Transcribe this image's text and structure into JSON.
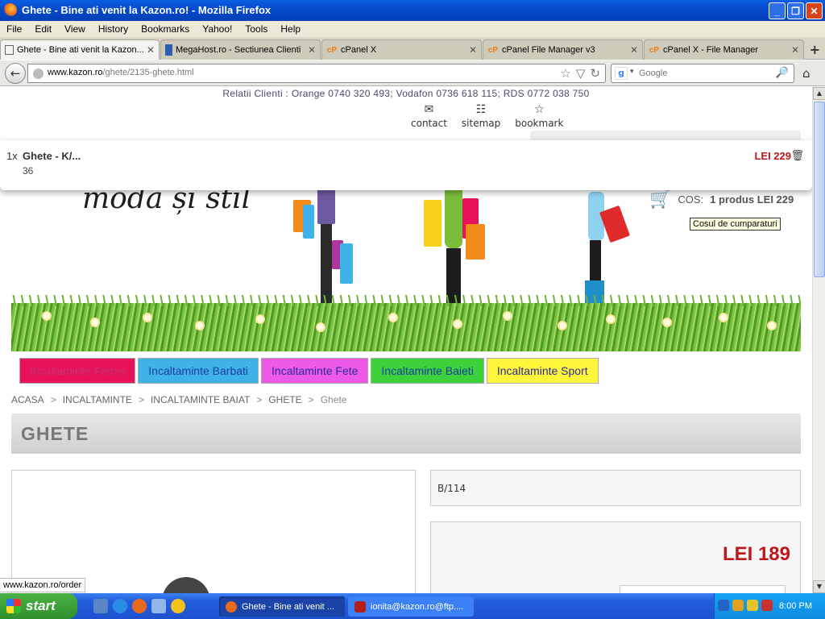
{
  "window": {
    "title": "Ghete - Bine ati venit la Kazon.ro! - Mozilla Firefox",
    "buttons": {
      "minimize": "_",
      "maximize": "❐",
      "close": "✕"
    }
  },
  "menu": [
    "File",
    "Edit",
    "View",
    "History",
    "Bookmarks",
    "Yahoo!",
    "Tools",
    "Help"
  ],
  "tabs": [
    {
      "label": "Ghete - Bine ati venit la Kazon...",
      "icon": "page-icon",
      "active": true
    },
    {
      "label": "MegaHost.ro - Sectiunea Clienti",
      "icon": "megahost-icon",
      "active": false
    },
    {
      "label": "cPanel X",
      "icon": "cpanel-icon",
      "active": false
    },
    {
      "label": "cPanel File Manager v3",
      "icon": "cpanel-icon",
      "active": false
    },
    {
      "label": "cPanel X - File Manager",
      "icon": "cpanel-icon",
      "active": false
    }
  ],
  "tab_icons": {
    "cpanel": "cP",
    "close": "✕",
    "new_tab": "+"
  },
  "nav": {
    "back": "←",
    "url_domain": "www.kazon.ro",
    "url_path": "/ghete/2135-ghete.html",
    "search_placeholder": "Google",
    "search_engine_icon": "g",
    "icons": {
      "star": "☆",
      "dropdown": "▽",
      "reload": "↻",
      "search": "🔎",
      "home": "⌂",
      "engine_dropdown": "▾"
    }
  },
  "site": {
    "contact_line": "Relatii Clienti : Orange 0740 320 493; Vodafon 0736 618 115; RDS 0772 038 750",
    "toplinks": [
      {
        "label": "contact",
        "icon": "envelope-icon",
        "glyph": "✉"
      },
      {
        "label": "sitemap",
        "icon": "sitemap-icon",
        "glyph": "☷"
      },
      {
        "label": "bookmark",
        "icon": "star-icon",
        "glyph": "☆"
      }
    ],
    "tagline": "modă și stil",
    "cart_label": "COS:",
    "cart_value": "1 produs LEI 229",
    "cart_icon": "🛒",
    "cart_tooltip": "Cosul de cumparaturi",
    "minicart": {
      "qty": "1x",
      "name": "Ghete - K/...",
      "size": "36",
      "price": "LEI 229",
      "trash": "🗑"
    },
    "categories": [
      {
        "label": "Incaltaminte Femei",
        "bg": "#e8125a",
        "color": "#c43470"
      },
      {
        "label": "Incaltaminte Barbati",
        "bg": "#3fb2e8",
        "color": "#1c3d9e"
      },
      {
        "label": "Incaltaminte Fete",
        "bg": "#ee5ae8",
        "color": "#2a2a9a"
      },
      {
        "label": "Incaltaminte Baieti",
        "bg": "#3bd23b",
        "color": "#1c3d9e"
      },
      {
        "label": "Incaltaminte Sport",
        "bg": "#fff83a",
        "color": "#2a2a9a"
      }
    ],
    "breadcrumb": [
      "ACASA",
      "INCALTAMINTE",
      "INCALTAMINTE BAIAT",
      "GHETE",
      "Ghete"
    ],
    "breadcrumb_sep": ">",
    "page_title": "GHETE",
    "product_code": "B/114",
    "product_price": "LEI 189"
  },
  "status_url": "www.kazon.ro/order",
  "taskbar": {
    "start": "start",
    "tasks": [
      {
        "label": "Ghete - Bine ati venit ...",
        "active": true
      },
      {
        "label": "ionita@kazon.ro@ftp....",
        "active": false
      }
    ],
    "clock": "8:00 PM"
  }
}
